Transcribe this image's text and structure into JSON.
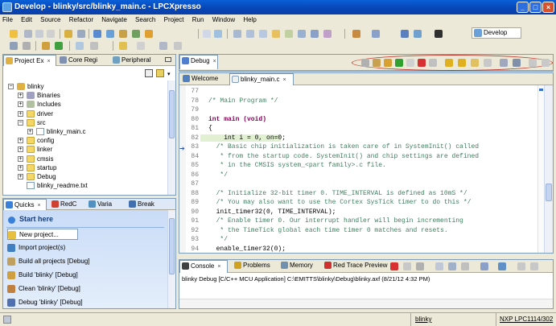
{
  "window": {
    "title": "Develop - blinky/src/blinky_main.c - LPCXpresso",
    "minimize_glyph": "_",
    "maximize_glyph": "□",
    "close_glyph": "×"
  },
  "menu": [
    "File",
    "Edit",
    "Source",
    "Refactor",
    "Navigate",
    "Search",
    "Project",
    "Run",
    "Window",
    "Help"
  ],
  "perspective": {
    "label": "Develop"
  },
  "project_explorer": {
    "tabs": [
      {
        "label": "Project Ex",
        "close": "×"
      },
      {
        "label": "Core Regi",
        "close": ""
      },
      {
        "label": "Peripheral",
        "close": ""
      }
    ],
    "tree": [
      {
        "label": "blinky",
        "indent": 0,
        "expander": "−",
        "icon": "project-icon"
      },
      {
        "label": "Binaries",
        "indent": 1,
        "expander": "+",
        "icon": "binaries-icon"
      },
      {
        "label": "Includes",
        "indent": 1,
        "expander": "+",
        "icon": "includes-icon"
      },
      {
        "label": "driver",
        "indent": 1,
        "expander": "+",
        "icon": "folder-icon"
      },
      {
        "label": "src",
        "indent": 1,
        "expander": "−",
        "icon": "folder-icon"
      },
      {
        "label": "blinky_main.c",
        "indent": 2,
        "expander": "+",
        "icon": "c-file-icon"
      },
      {
        "label": "config",
        "indent": 1,
        "expander": "+",
        "icon": "folder-icon"
      },
      {
        "label": "linker",
        "indent": 1,
        "expander": "+",
        "icon": "folder-icon"
      },
      {
        "label": "cmsis",
        "indent": 1,
        "expander": "+",
        "icon": "folder-icon"
      },
      {
        "label": "startup",
        "indent": 1,
        "expander": "+",
        "icon": "folder-icon"
      },
      {
        "label": "Debug",
        "indent": 1,
        "expander": "+",
        "icon": "folder-icon"
      },
      {
        "label": "blinky_readme.txt",
        "indent": 1,
        "expander": "",
        "icon": "text-file-icon"
      }
    ]
  },
  "debug_view": {
    "tab_label": "Debug",
    "close": "×"
  },
  "editor": {
    "tabs": [
      {
        "label": "Welcome",
        "close": ""
      },
      {
        "label": "blinky_main.c",
        "close": "×"
      }
    ],
    "lines": [
      {
        "num": "77",
        "text": "",
        "cls": ""
      },
      {
        "num": "78",
        "text": "/* Main Program */",
        "cls": "cm"
      },
      {
        "num": "79",
        "text": "",
        "cls": ""
      },
      {
        "num": "80",
        "text": "int main (void)",
        "cls": "kwline"
      },
      {
        "num": "81",
        "text": "{",
        "cls": ""
      },
      {
        "num": "82",
        "text": "    int i = 0, on=0;",
        "cls": "hl"
      },
      {
        "num": "83",
        "text": "  /* Basic chip initialization is taken care of in SystemInit() called",
        "cls": "cm"
      },
      {
        "num": "84",
        "text": "   * from the startup code. SystemInit() and chip settings are defined",
        "cls": "cm"
      },
      {
        "num": "85",
        "text": "   * in the CMSIS system_<part family>.c file.",
        "cls": "cm"
      },
      {
        "num": "86",
        "text": "   */",
        "cls": "cm"
      },
      {
        "num": "87",
        "text": "",
        "cls": ""
      },
      {
        "num": "88",
        "text": "  /* Initialize 32-bit timer 0. TIME_INTERVAL is defined as 10mS */",
        "cls": "cm"
      },
      {
        "num": "89",
        "text": "  /* You may also want to use the Cortex SysTick timer to do this */",
        "cls": "cm"
      },
      {
        "num": "90",
        "text": "  init_timer32(0, TIME_INTERVAL);",
        "cls": ""
      },
      {
        "num": "91",
        "text": "  /* Enable timer 0. Our interrupt handler will begin incrementing",
        "cls": "cm"
      },
      {
        "num": "92",
        "text": "   * the TimeTick global each time timer 0 matches and resets.",
        "cls": "cm"
      },
      {
        "num": "93",
        "text": "   */",
        "cls": "cm"
      },
      {
        "num": "94",
        "text": "  enable_timer32(0);",
        "cls": ""
      }
    ]
  },
  "quickstart": {
    "tabs": [
      {
        "label": "Quicks",
        "close": "×"
      },
      {
        "label": "RedC",
        "close": ""
      },
      {
        "label": "Varia",
        "close": ""
      },
      {
        "label": "Break",
        "close": ""
      }
    ],
    "header": "Start here",
    "items": [
      {
        "label": "New project...",
        "icon": "new-project-icon"
      },
      {
        "label": "Import project(s)",
        "icon": "import-icon"
      },
      {
        "label": "Build all projects [Debug]",
        "icon": "build-all-icon"
      },
      {
        "label": "Build 'blinky' [Debug]",
        "icon": "build-icon"
      },
      {
        "label": "Clean 'blinky' [Debug]",
        "icon": "clean-icon"
      },
      {
        "label": "Debug 'blinky' [Debug]",
        "icon": "debug-icon"
      }
    ]
  },
  "console": {
    "tabs": [
      {
        "label": "Console",
        "close": "×"
      },
      {
        "label": "Problems",
        "close": ""
      },
      {
        "label": "Memory",
        "close": ""
      },
      {
        "label": "Red Trace Preview",
        "close": ""
      }
    ],
    "description": "blinky Debug [C/C++ MCU Application] C:\\EMITTS\\blinky\\Debug\\blinky.axf (8/21/12 4:32 PM)"
  },
  "status": {
    "project": "blinky",
    "target": "NXP LPC1114/302"
  },
  "colors": {
    "titlebar": "#0747b7",
    "debug_highlight_ring": "#c0392b",
    "current_line": "#e0f0d0",
    "comment": "#3f7f5f",
    "keyword": "#7f0055"
  }
}
